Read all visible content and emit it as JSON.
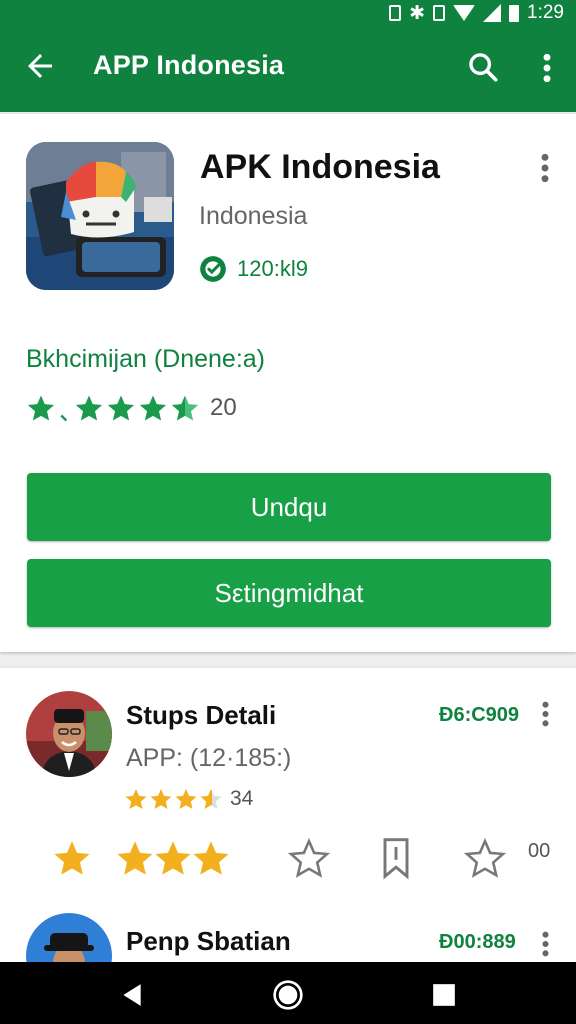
{
  "status_bar": {
    "time": "1:29"
  },
  "app_bar": {
    "title": "APP Indonesia",
    "icons": [
      "back-arrow-icon",
      "search-icon",
      "more-vert-icon"
    ]
  },
  "app": {
    "title": "APK Indonesia",
    "subtitle": "Indonesia",
    "badge": "120:kl9",
    "tagline": "Bkhcimijan (Dnene:a)",
    "rating_count": "20",
    "rating_stars": 4.5,
    "primary_button": "Undqu",
    "secondary_button": "Sεtingmidhat"
  },
  "reviews": [
    {
      "name": "Stups Detali",
      "code": "Ð6:C909",
      "app": "APP: (12·185:)",
      "rating_value": "34",
      "rating_stars": 3.5
    },
    {
      "name": "Penp Sbatian",
      "code": "Ð00:889"
    }
  ],
  "review_actions": {
    "count": "00"
  },
  "colors": {
    "primary": "#10823f",
    "button": "#18a047",
    "star_green": "#1a9a4a",
    "star_gold": "#f2b01e"
  }
}
